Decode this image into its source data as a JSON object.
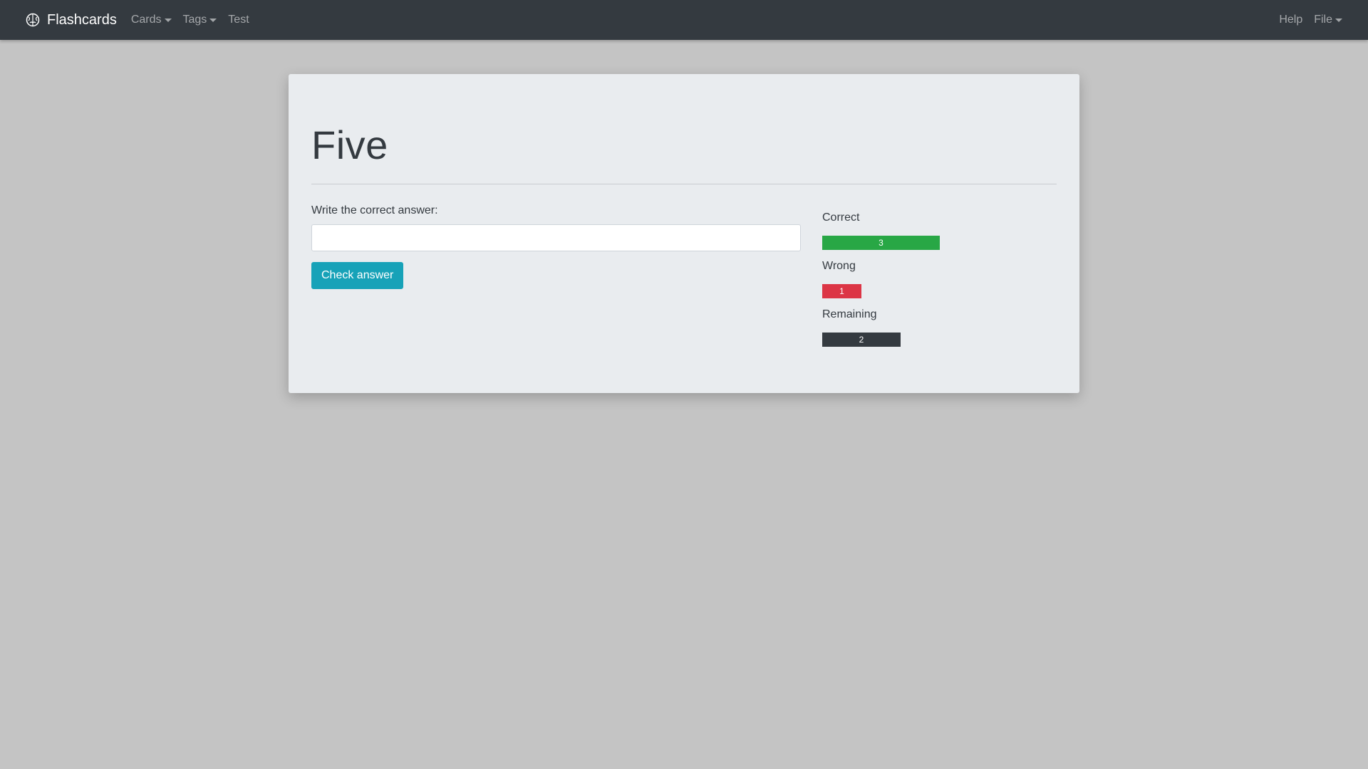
{
  "navbar": {
    "brand": "Flashcards",
    "brand_icon": "brain-icon",
    "items": [
      {
        "label": "Cards",
        "dropdown": true
      },
      {
        "label": "Tags",
        "dropdown": true
      },
      {
        "label": "Test",
        "dropdown": false
      }
    ],
    "right_items": [
      {
        "label": "Help",
        "dropdown": false
      },
      {
        "label": "File",
        "dropdown": true
      }
    ]
  },
  "card": {
    "title": "Five",
    "answer_label": "Write the correct answer:",
    "answer_value": "",
    "answer_placeholder": "",
    "check_button": "Check answer"
  },
  "stats": {
    "correct_label": "Correct",
    "correct_value": "3",
    "wrong_label": "Wrong",
    "wrong_value": "1",
    "remaining_label": "Remaining",
    "remaining_value": "2"
  },
  "colors": {
    "navbar_bg": "#343a40",
    "panel_bg": "#e9ecef",
    "page_bg": "#c4c4c4",
    "button": "#17a2b8",
    "correct": "#28a745",
    "wrong": "#dc3545",
    "remaining": "#343a40"
  }
}
